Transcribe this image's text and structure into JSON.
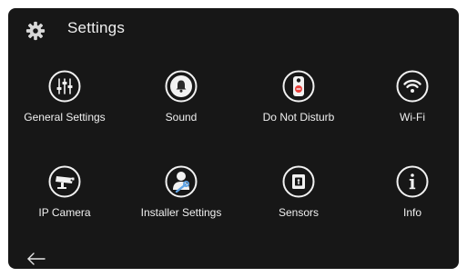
{
  "header": {
    "title": "Settings",
    "icon": "gear-icon"
  },
  "tiles": [
    {
      "label": "General Settings",
      "icon": "sliders-icon"
    },
    {
      "label": "Sound",
      "icon": "bell-icon"
    },
    {
      "label": "Do Not Disturb",
      "icon": "do-not-disturb-icon"
    },
    {
      "label": "Wi-Fi",
      "icon": "wifi-icon"
    },
    {
      "label": "IP Camera",
      "icon": "camera-icon"
    },
    {
      "label": "Installer Settings",
      "icon": "installer-icon"
    },
    {
      "label": "Sensors",
      "icon": "sensor-icon"
    },
    {
      "label": "Info",
      "icon": "info-icon"
    }
  ],
  "footer": {
    "back_icon": "back-arrow-icon"
  },
  "colors": {
    "background": "#171717",
    "foreground": "#f2f2f2",
    "accent_red": "#e8403b"
  }
}
